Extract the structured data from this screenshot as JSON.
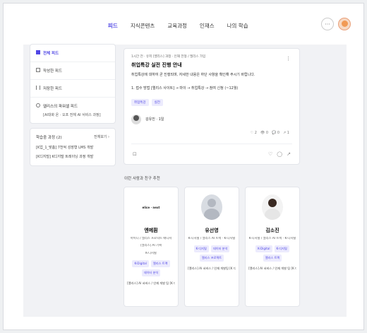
{
  "nav": {
    "items": [
      "피드",
      "지식콘텐츠",
      "교육과정",
      "인재스",
      "나의 학습"
    ],
    "active_index": 0
  },
  "top_icons": {
    "more": "···"
  },
  "sidebar": {
    "items": [
      {
        "label": "전체 피드",
        "icon": "home-icon",
        "selected": true
      },
      {
        "label": "작성한 피드",
        "icon": "list-icon"
      },
      {
        "label": "저장한 피드",
        "icon": "bookmark-icon"
      },
      {
        "label": "엘리스의 파워셀 피드",
        "icon": "person-icon",
        "sub": "[AI대화 온 · 오프 전체 AI 서비스 과정]"
      }
    ],
    "study": {
      "title": "학습중 과정 (2)",
      "link": "전체보기 ›",
      "rows": [
        "[K업_1_맞춤] 7천억 성장형 LMS 개발",
        "[K디지털] K디지털 트레이닝 과정 개발"
      ]
    }
  },
  "post": {
    "meta": "1시간 전 · 유저 [엘리스] 과정 · 인재 전형 / 엘리스 가입",
    "title": "취업특강 실전 진행 안내",
    "body": "취업특강에 대하여 곧 진행되며, 자세한 내용은 하단 사항을 확인해 주시기 바랍니다.",
    "path": "1. 접수 방법 [엘리스 사이트] → 마이 → 취업특강 → 참여 신청 (~12월)",
    "tags": [
      "취업특강",
      "실전"
    ],
    "author": "김유진 · 1일",
    "stats": [
      "♡ 2",
      "👁 0",
      "💬 0",
      "↗ 1"
    ],
    "actions": {
      "bookmark": "⊡",
      "like": "♡",
      "comment": "◯",
      "share": "↗"
    }
  },
  "recommend": {
    "title": "이런 사람과 친구 추천",
    "cards": [
      {
        "logo": "elice · next",
        "name": "엔메훤",
        "desc": [
          "아이디 / 엘리스 프로덕트 매니저",
          "[엘리스] AI 기획",
          "K-디지털"
        ],
        "tags": [
          "K-Digital",
          "엘리스 트랙"
        ],
        "extra_tags": [
          "데이터 분석"
        ],
        "org": "[엘리스] AI 서비스 / 인재 개발 팀 [K 디지털]"
      },
      {
        "logo": "",
        "name": "유선영",
        "desc": [
          "K-디지털 / 엘리스 AI 트랙 · K-디지털"
        ],
        "tags": [
          "K-디지털",
          "데이터 분석"
        ],
        "extra_tags": [
          "엘리스 프로젝트"
        ],
        "org": "[엘리스] AI 서비스 / 인재 개발팀 [K 디지털]"
      },
      {
        "logo": "",
        "name": "김소진",
        "desc": [
          "K-디지털 / 엘리스 AI 트랙 · K-디지털"
        ],
        "tags": [
          "K-Digital",
          "K-디지털"
        ],
        "extra_tags": [
          "엘리스 트랙"
        ],
        "org": "[엘리스] AI 서비스 / 인재 개발 팀 [K 디지털]"
      }
    ]
  },
  "colors": {
    "accent": "#4f46e5",
    "tag_bg": "#ecebfd",
    "background": "#f1f2f5"
  }
}
